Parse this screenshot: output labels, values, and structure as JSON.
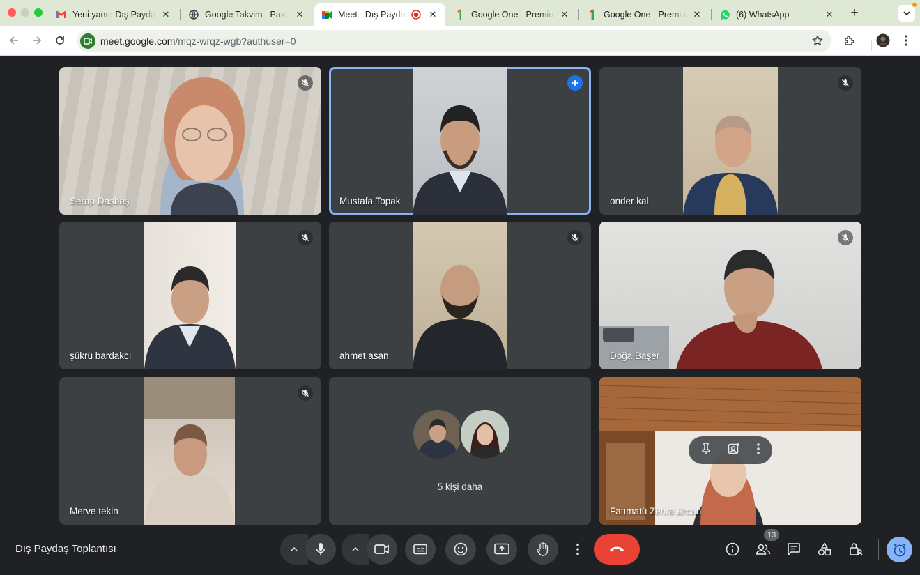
{
  "browser": {
    "tabs": [
      {
        "title": "Yeni yanıt: Dış Paydaş Toplantısı",
        "favicon": "gmail-icon",
        "active": false
      },
      {
        "title": "Google Takvim - Pazartesi",
        "favicon": "globe-icon",
        "active": false
      },
      {
        "title": "Meet - Dış Paydaş Toplantısı",
        "favicon": "meet-icon",
        "active": true,
        "recording": true
      },
      {
        "title": "Google One - Premium planı",
        "favicon": "google-one-icon",
        "active": false
      },
      {
        "title": "Google One - Premium planı",
        "favicon": "google-one-icon",
        "active": false
      },
      {
        "title": "(6) WhatsApp",
        "favicon": "whatsapp-icon",
        "active": false
      }
    ],
    "close_glyph": "✕",
    "new_tab_glyph": "+",
    "url_host": "meet.google.com",
    "url_path": "/mqz-wrqz-wgb?authuser=0"
  },
  "meet": {
    "participants": [
      {
        "name": "Serap Daşbaş",
        "muted": true,
        "speaking": false
      },
      {
        "name": "Mustafa Topak",
        "muted": false,
        "speaking": true
      },
      {
        "name": "onder kal",
        "muted": true,
        "speaking": false
      },
      {
        "name": "şükrü bardakcı",
        "muted": true,
        "speaking": false
      },
      {
        "name": "ahmet asan",
        "muted": true,
        "speaking": false
      },
      {
        "name": "Doğa Başer",
        "muted": true,
        "speaking": false
      },
      {
        "name": "Merve tekin",
        "muted": true,
        "speaking": false
      },
      {
        "name": "Fatımatü Zehra Ercan",
        "muted": false,
        "speaking": false
      }
    ],
    "more_people_label": "5 kişi daha",
    "meeting_title": "Dış Paydaş Toplantısı",
    "people_count": "13"
  },
  "colors": {
    "background": "#202124",
    "tile": "#3c4043",
    "accent": "#8ab4f8",
    "leave": "#ea4335",
    "tabstrip": "#dfe8d4"
  }
}
